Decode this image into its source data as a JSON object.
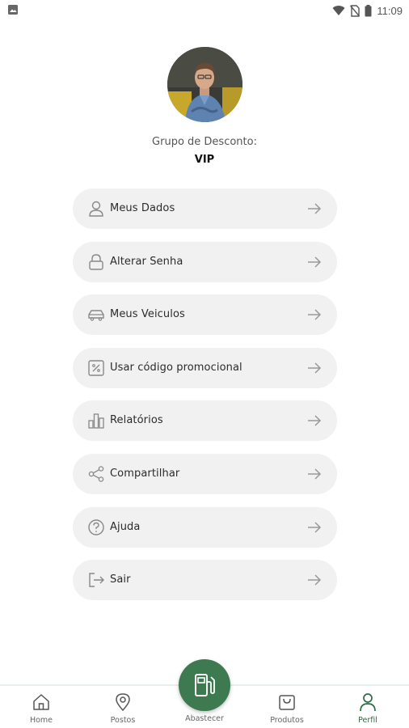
{
  "status_bar": {
    "time": "11:09",
    "left_icon": "image-icon",
    "right_icons": [
      "wifi-icon",
      "no-sim-icon",
      "battery-icon"
    ]
  },
  "profile": {
    "avatar": "profile-photo",
    "group_label": "Grupo de Desconto:",
    "group_value": "VIP"
  },
  "menu": {
    "items": [
      {
        "label": "Meus Dados",
        "icon": "user-icon"
      },
      {
        "label": "Alterar Senha",
        "icon": "lock-icon"
      },
      {
        "label": "Meus Veiculos",
        "icon": "car-icon"
      },
      {
        "label": "Usar código promocional",
        "icon": "percent-icon"
      },
      {
        "label": "Relatórios",
        "icon": "bar-chart-icon"
      },
      {
        "label": "Compartilhar",
        "icon": "share-icon"
      },
      {
        "label": "Ajuda",
        "icon": "help-icon"
      },
      {
        "label": "Sair",
        "icon": "logout-icon"
      }
    ],
    "arrow_icon": "arrow-right-icon"
  },
  "bottom_nav": {
    "items": [
      {
        "label": "Home",
        "icon": "home-icon"
      },
      {
        "label": "Postos",
        "icon": "map-pin-icon"
      },
      {
        "label": "Abastecer",
        "icon": "fuel-pump-icon"
      },
      {
        "label": "Produtos",
        "icon": "shopping-bag-icon"
      },
      {
        "label": "Perfil",
        "icon": "user-icon",
        "active": true
      }
    ]
  },
  "colors": {
    "accent": "#3d7a4f",
    "menu_bg": "#f1f1f1",
    "text": "#2b2b2b"
  }
}
